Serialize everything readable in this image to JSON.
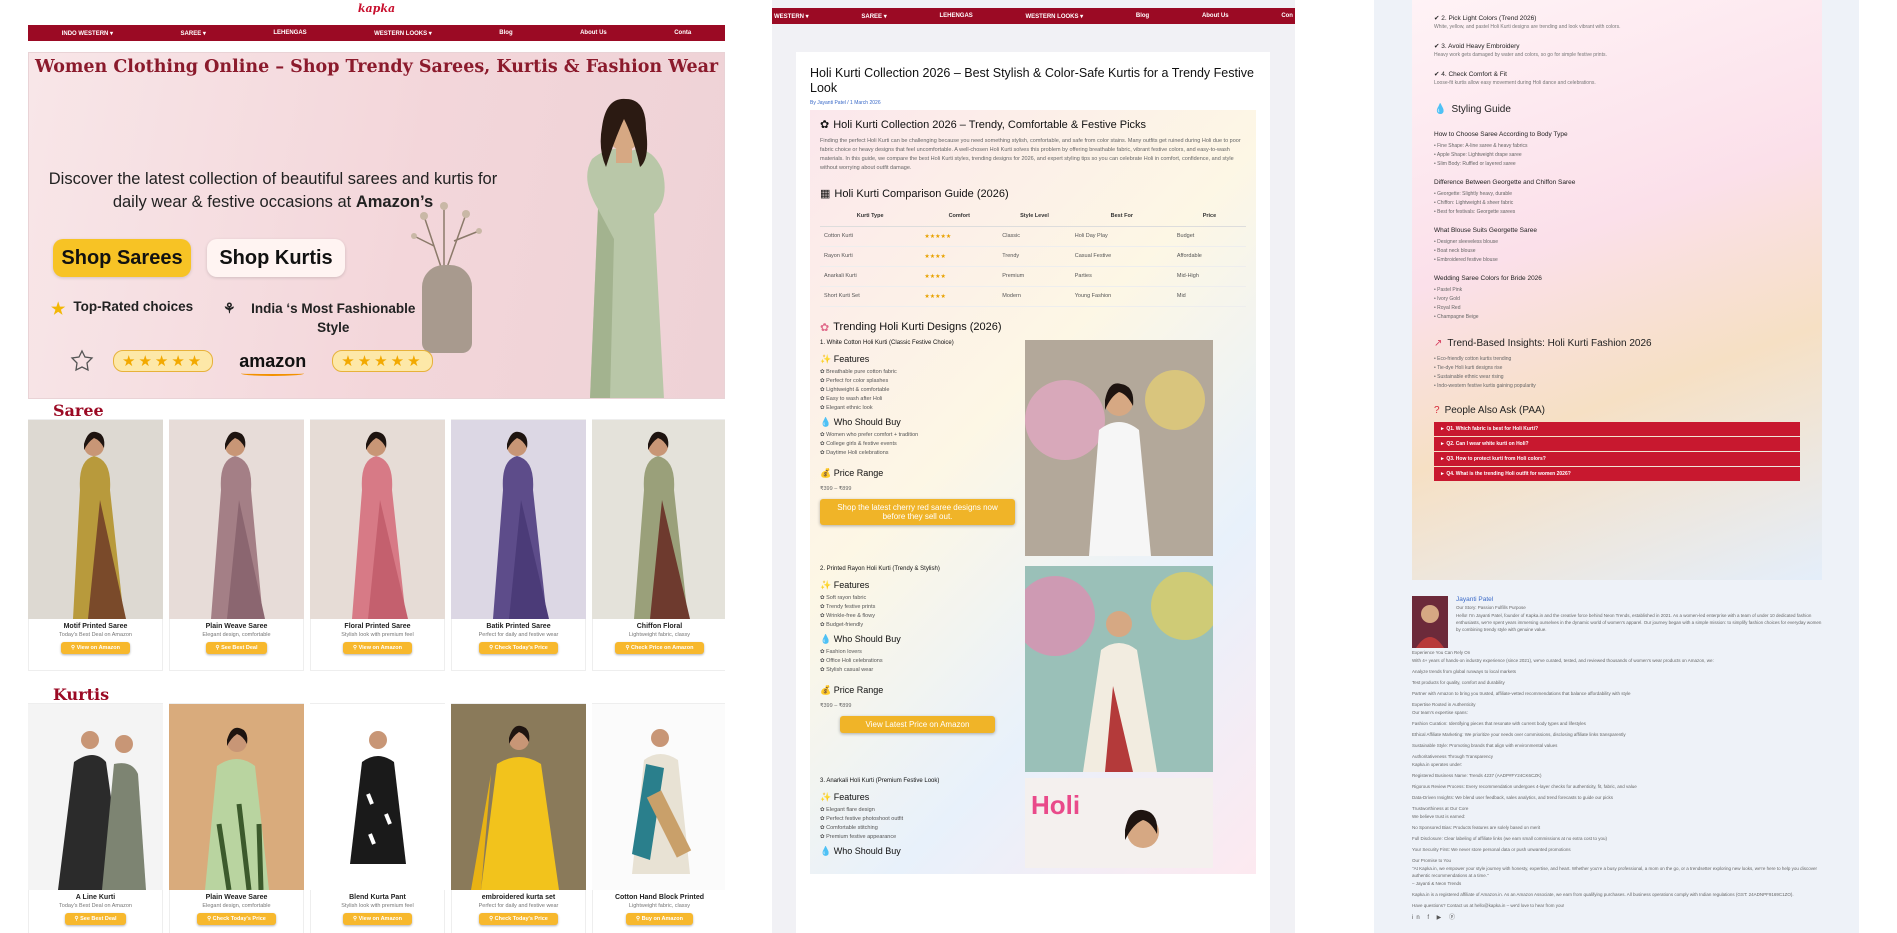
{
  "panel1": {
    "logo": "kapka",
    "nav": [
      "INDO WESTERN ▾",
      "SAREE ▾",
      "LEHENGAS",
      "WESTERN LOOKS ▾",
      "Blog",
      "About Us",
      "Conta"
    ],
    "hero": {
      "title": "Women Clothing Online – Shop Trendy Sarees, Kurtis & Fashion Wear",
      "subtitle_pre": "Discover the latest collection of beautiful sarees and kurtis for daily wear & festive occasions at ",
      "subtitle_bold": "Amazon’s",
      "btn_sarees": "Shop Sarees",
      "btn_kurtis": "Shop Kurtis",
      "feature1": "Top-Rated choices",
      "feature2": "India ‘s Most Fashionable Style",
      "stars": "★★★★★",
      "amazon": "amazon"
    },
    "saree_title": "Saree",
    "sarees": [
      {
        "name": "Motif Printed Saree",
        "desc": "Today's Best Deal on Amazon",
        "btn": "⚲ View on Amazon"
      },
      {
        "name": "Plain Weave Saree",
        "desc": "Elegant design, comfortable",
        "btn": "⚲ See Best Deal"
      },
      {
        "name": "Floral Printed Saree",
        "desc": "Stylish look with premium feel",
        "btn": "⚲ View on Amazon"
      },
      {
        "name": "Batik Printed Saree",
        "desc": "Perfect for daily and festive wear",
        "btn": "⚲ Check Today's Price"
      },
      {
        "name": "Chiffon Floral",
        "desc": "Lightweight fabric, classy",
        "btn": "⚲ Check Price on Amazon"
      }
    ],
    "kurtis_title": "Kurtis",
    "kurtis": [
      {
        "name": "A Line Kurti",
        "desc": "Today's Best Deal on Amazon",
        "btn": "⚲ See Best Deal"
      },
      {
        "name": "Plain Weave Saree",
        "desc": "Elegant design, comfortable",
        "btn": "⚲ Check Today's Price"
      },
      {
        "name": "Blend Kurta Pant",
        "desc": "Stylish look with premium feel",
        "btn": "⚲ View on Amazon"
      },
      {
        "name": "embroidered kurta set",
        "desc": "Perfect for daily and festive wear",
        "btn": "⚲ Check Today's Price"
      },
      {
        "name": "Cotton Hand Block Printed",
        "desc": "Lightweight fabric, classy",
        "btn": "⚲ Buy on Amazon"
      }
    ]
  },
  "panel2": {
    "nav": [
      "WESTERN ▾",
      "SAREE ▾",
      "LEHENGAS",
      "WESTERN LOOKS ▾",
      "Blog",
      "About Us",
      "Con"
    ],
    "title": "Holi Kurti Collection 2026 – Best Stylish & Color-Safe Kurtis for a Trendy Festive Look",
    "meta": "By Jayanti Patel / 1 March 2026",
    "intro_title": "Holi Kurti Collection 2026 – Trendy, Comfortable & Festive Picks",
    "intro_text": "Finding the perfect Holi Kurti can be challenging because you need something stylish, comfortable, and safe from color stains. Many outfits get ruined during Holi due to poor fabric choice or heavy designs that feel uncomfortable. A well-chosen Holi Kurti solves this problem by offering breathable fabric, vibrant festive colors, and easy-to-wash materials. In this guide, we compare the best Holi Kurti styles, trending designs for 2026, and expert styling tips so you can celebrate Holi in comfort, confidence, and style without worrying about outfit damage.",
    "table_title": "Holi Kurti Comparison Guide (2026)",
    "table_head": [
      "Kurti Type",
      "Comfort",
      "Style Level",
      "Best For",
      "Price"
    ],
    "table_rows": [
      [
        "Cotton Kurti",
        "★★★★★",
        "Classic",
        "Holi Day Play",
        "Budget"
      ],
      [
        "Rayon Kurti",
        "★★★★",
        "Trendy",
        "Casual Festive",
        "Affordable"
      ],
      [
        "Anarkali Kurti",
        "★★★★",
        "Premium",
        "Parties",
        "Mid-High"
      ],
      [
        "Short Kurti Set",
        "★★★★",
        "Modern",
        "Young Fashion",
        "Mid"
      ]
    ],
    "trending_title": "Trending Holi Kurti Designs (2026)",
    "designs": [
      {
        "heading": "1. White Cotton Holi Kurti (Classic Festive Choice)",
        "features_title": "Features",
        "features": [
          "Breathable pure cotton fabric",
          "Perfect for color splashes",
          "Lightweight & comfortable",
          "Easy to wash after Holi",
          "Elegant ethnic look"
        ],
        "who_title": "Who Should Buy",
        "who": [
          "Women who prefer comfort + tradition",
          "College girls & festive events",
          "Daytime Holi celebrations"
        ],
        "price_title": "Price Range",
        "price": "₹399 – ₹899",
        "btn": "Shop the latest cherry red saree designs now before they sell out."
      },
      {
        "heading": "2. Printed Rayon Holi Kurti (Trendy & Stylish)",
        "features_title": "Features",
        "features": [
          "Soft rayon fabric",
          "Trendy festive prints",
          "Wrinkle-free & flowy",
          "Budget-friendly"
        ],
        "who_title": "Who Should Buy",
        "who": [
          "Fashion lovers",
          "Office Holi celebrations",
          "Stylish casual wear"
        ],
        "price_title": "Price Range",
        "price": "₹399 – ₹899",
        "btn": "View Latest Price on Amazon"
      },
      {
        "heading": "3. Anarkali Holi Kurti (Premium Festive Look)",
        "features_title": "Features",
        "features": [
          "Elegant flare design",
          "Perfect festive photoshoot outfit",
          "Comfortable stitching",
          "Premium festive appearance"
        ],
        "who_title": "Who Should Buy"
      }
    ]
  },
  "panel3": {
    "tips": [
      {
        "title": "✔ 2. Pick Light Colors (Trend 2026)",
        "text": "White, yellow, and pastel Holi Kurti designs are trending and look vibrant with colors."
      },
      {
        "title": "✔ 3. Avoid Heavy Embroidery",
        "text": "Heavy work gets damaged by water and colors, so go for simple festive prints."
      },
      {
        "title": "✔ 4. Check Comfort & Fit",
        "text": "Loose-fit kurtis allow easy movement during Holi dance and celebrations."
      }
    ],
    "styling_title": "Styling Guide",
    "guides": [
      {
        "title": "How to Choose Saree According to Body Type",
        "items": [
          "Fine Shape: A-line saree & heavy fabrics",
          "Apple Shape: Lightweight drape saree",
          "Slim Body: Ruffled or layered saree"
        ]
      },
      {
        "title": "Difference Between Georgette and Chiffon Saree",
        "items": [
          "Georgette: Slightly heavy, durable",
          "Chiffon: Lightweight & sheer fabric",
          "Best for festivals: Georgette sarees"
        ]
      },
      {
        "title": "What Blouse Suits Georgette Saree",
        "items": [
          "Designer sleeveless blouse",
          "Boat neck blouse",
          "Embroidered festive blouse"
        ]
      },
      {
        "title": "Wedding Saree Colors for Bride 2026",
        "items": [
          "Pastel Pink",
          "Ivory Gold",
          "Royal Red",
          "Champagne Beige"
        ]
      }
    ],
    "insights_title": "Trend-Based Insights: Holi Kurti Fashion 2026",
    "insights": [
      "Eco-friendly cotton kurtis trending",
      "Tie-dye Holi kurti designs rise",
      "Sustainable ethnic wear rising",
      "Indo-western festive kurtis gaining popularity"
    ],
    "paa_title": "People Also Ask (PAA)",
    "paa": [
      "► Q1. Which fabric is best for Holi Kurti?",
      "► Q2. Can I wear white kurti on Holi?",
      "► Q3. How to protect kurti from Holi colors?",
      "► Q4. What is the trending Holi outfit for women 2026?"
    ],
    "author_name": "Jayanti Patel",
    "author_role": "Our Story: Passion Fulfills Purpose",
    "author_text": "Hello! I'm Jayanti Patel, founder of Kapka.in and the creative force behind Neon Trends, established in 2021. As a women-led enterprise with a team of under 10 dedicated fashion enthusiasts, we're spent years immersing ourselves in the dynamic world of women's apparel. Our journey began with a simple mission: to simplify fashion choices for everyday women by combining trendy style with genuine value.",
    "lines": [
      "Experience You Can Rely On",
      "With 4+ years of hands-on industry experience (since 2021), we've curated, tested, and reviewed thousands of women's wear products on Amazon, we:",
      "Analyze trends from global runways to local markets",
      "Test products for quality, comfort and durability",
      "Partner with Amazon to bring you trusted, affiliate-vetted recommendations that balance affordability with style",
      "Expertise Rooted in Authenticity",
      "Our team's expertise spans:",
      "Fashion Curation: Identifying pieces that resonate with current body types and lifestyles",
      "Ethical Affiliate Marketing: We prioritize your needs over commissions, disclosing affiliate links transparently",
      "Sustainable Style: Promoting brands that align with environmental values",
      "Authoritativeness Through Transparency",
      "Kapka.in operates under:",
      "Registered Business Name: Trends 4237 (AADP#FY24CK6CZK)",
      "Rigorous Review Process: Every recommendation undergoes 4-layer checks for authenticity, fit, fabric, and value",
      "Data-Driven Insights: We blend user feedback, sales analytics, and trend forecasts to guide our picks",
      "Trustworthiness at Our Core",
      "We believe trust is earned:",
      "No Sponsored Bias: Products features are solely based on merit",
      "Full Disclosure: Clear labeling of affiliate links (we earn small commissions at no extra cost to you)",
      "Your Security First: We never store personal data or push unwanted promotions",
      "Our Promise to You",
      "\"At Kapka.in, we empower your style journey with honesty, expertise, and heart. Whether you're a busy professional, a mom on the go, or a trendsetter exploring new looks, we're here to help you discover authentic recommendations at a time.\"",
      "– Jayanti & Neon Trends",
      "Kapka.in is a registered affiliate of Amazon.in. As an Amazon Associate, we earn from qualifying purchases. All business operations comply with Indian regulations (GST: 24ADNPF9169C1ZO).",
      "Have questions? Contact us at hello@kapka.in – we'd love to hear from you!"
    ],
    "social": "in f ▶ ⓟ"
  }
}
